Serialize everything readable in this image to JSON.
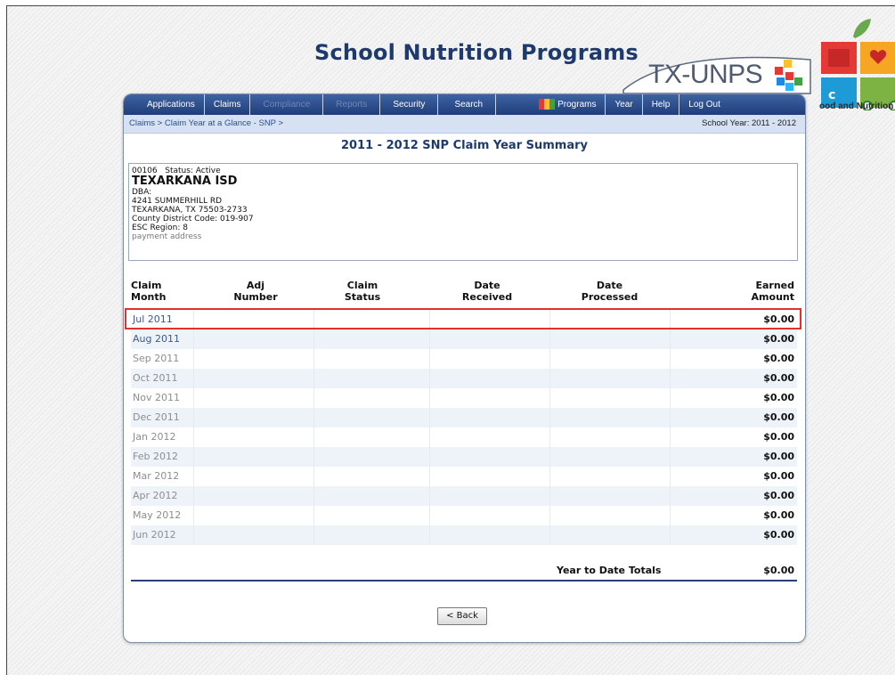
{
  "header": {
    "site_title": "School Nutrition Programs",
    "brand": "TX-UNPS",
    "logo_caption": "ood and Nutrition"
  },
  "nav": {
    "items": [
      {
        "label": "Applications",
        "enabled": true
      },
      {
        "label": "Claims",
        "enabled": true
      },
      {
        "label": "Compliance",
        "enabled": false
      },
      {
        "label": "Reports",
        "enabled": false
      },
      {
        "label": "Security",
        "enabled": true
      },
      {
        "label": "Search",
        "enabled": true
      },
      {
        "label": "Programs",
        "enabled": true,
        "icon": "programs-grid-icon"
      },
      {
        "label": "Year",
        "enabled": true
      },
      {
        "label": "Help",
        "enabled": true
      },
      {
        "label": "Log Out",
        "enabled": true
      }
    ]
  },
  "breadcrumb": {
    "claims": "Claims",
    "separator": ">",
    "glance": "Claim Year at a Glance - SNP",
    "trail_end": ">",
    "school_year": "School Year: 2011 - 2012"
  },
  "summary": {
    "title": "2011 - 2012 SNP Claim Year Summary"
  },
  "sponsor": {
    "id": "00106",
    "status": "Status: Active",
    "name": "TEXARKANA ISD",
    "dba": "DBA:",
    "address1": "4241 SUMMERHILL RD",
    "address2": "TEXARKANA, TX 75503-2733",
    "county_district": "County District Code: 019-907",
    "esc_region": "ESC Region: 8",
    "address_type": "payment address"
  },
  "table": {
    "headers": {
      "claim_month": [
        "Claim",
        "Month"
      ],
      "adj_number": [
        "Adj",
        "Number"
      ],
      "claim_status": [
        "Claim",
        "Status"
      ],
      "date_received": [
        "Date",
        "Received"
      ],
      "date_processed": [
        "Date",
        "Processed"
      ],
      "earned_amount": [
        "Earned",
        "Amount"
      ]
    },
    "rows": [
      {
        "month": "Jul 2011",
        "amount": "$0.00",
        "link": true,
        "highlighted": true
      },
      {
        "month": "Aug 2011",
        "amount": "$0.00",
        "link": true
      },
      {
        "month": "Sep 2011",
        "amount": "$0.00"
      },
      {
        "month": "Oct 2011",
        "amount": "$0.00"
      },
      {
        "month": "Nov 2011",
        "amount": "$0.00"
      },
      {
        "month": "Dec 2011",
        "amount": "$0.00"
      },
      {
        "month": "Jan 2012",
        "amount": "$0.00"
      },
      {
        "month": "Feb 2012",
        "amount": "$0.00"
      },
      {
        "month": "Mar 2012",
        "amount": "$0.00"
      },
      {
        "month": "Apr 2012",
        "amount": "$0.00"
      },
      {
        "month": "May 2012",
        "amount": "$0.00"
      },
      {
        "month": "Jun 2012",
        "amount": "$0.00"
      }
    ],
    "totals_label": "Year to Date Totals",
    "totals_value": "$0.00"
  },
  "actions": {
    "back_label": "< Back"
  },
  "colors": {
    "nav_bg": "#1f3d7a",
    "title": "#1d3a6e",
    "highlight_border": "#e3302b",
    "link": "#3a5896"
  }
}
